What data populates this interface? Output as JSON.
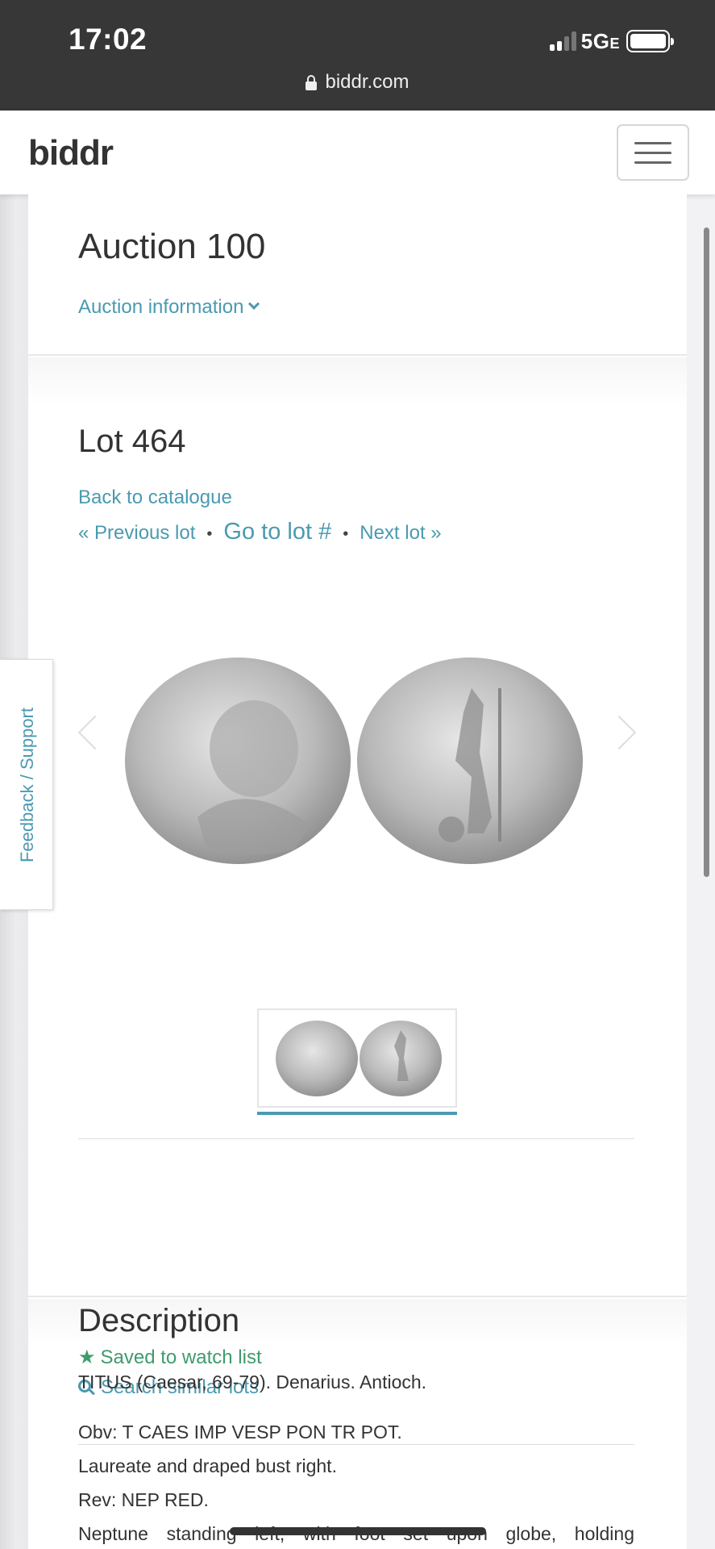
{
  "status_bar": {
    "time": "17:02",
    "network": "5G",
    "network_suffix": "E",
    "url": "biddr.com"
  },
  "navbar": {
    "brand": "biddr",
    "menu_icon": "hamburger-menu-icon"
  },
  "auction": {
    "title": "Auction 100",
    "info_link": "Auction information"
  },
  "lot": {
    "title": "Lot 464",
    "back_link": "Back to catalogue",
    "previous": "« Previous lot",
    "goto": "Go to lot #",
    "next": "Next lot »",
    "separator": "•"
  },
  "actions": {
    "watch": "Saved to watch list",
    "similar": "Search similar lots"
  },
  "description": {
    "heading": "Description",
    "line1": "TITUS (Caesar, 69-79). Denarius. Antioch.",
    "obv": "Obv: T CAES IMP VESP PON TR POT.",
    "obv_desc": "Laureate and draped bust right.",
    "rev": "Rev: NEP RED.",
    "rev_desc": "Neptune standing left, with foot set upon globe, holding"
  },
  "feedback_tab": "Feedback / Support",
  "colors": {
    "link": "#4a9ab0",
    "watch_green": "#3f9b6c",
    "status_bar_bg": "#373737"
  }
}
